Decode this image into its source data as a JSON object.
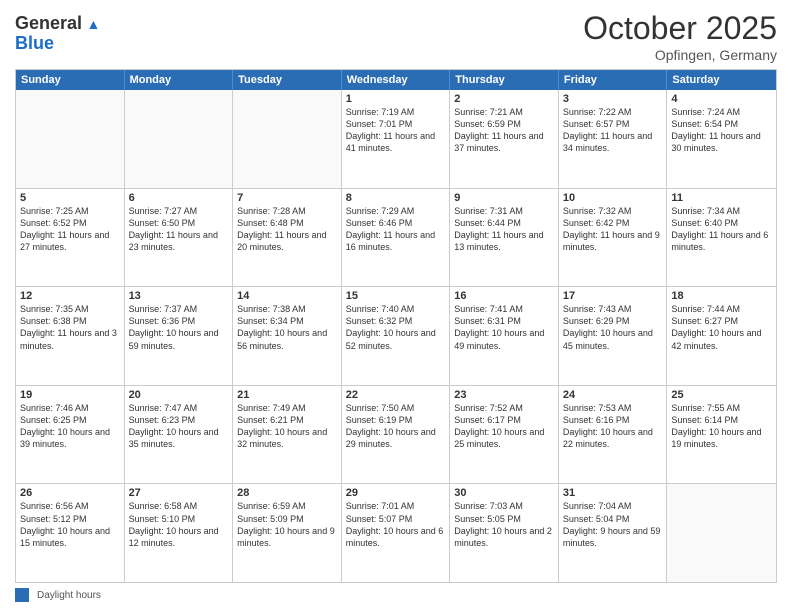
{
  "header": {
    "logo_general": "General",
    "logo_blue": "Blue",
    "title": "October 2025",
    "subtitle": "Opfingen, Germany"
  },
  "days_of_week": [
    "Sunday",
    "Monday",
    "Tuesday",
    "Wednesday",
    "Thursday",
    "Friday",
    "Saturday"
  ],
  "weeks": [
    [
      {
        "day": "",
        "sunrise": "",
        "sunset": "",
        "daylight": ""
      },
      {
        "day": "",
        "sunrise": "",
        "sunset": "",
        "daylight": ""
      },
      {
        "day": "",
        "sunrise": "",
        "sunset": "",
        "daylight": ""
      },
      {
        "day": "1",
        "sunrise": "Sunrise: 7:19 AM",
        "sunset": "Sunset: 7:01 PM",
        "daylight": "Daylight: 11 hours and 41 minutes."
      },
      {
        "day": "2",
        "sunrise": "Sunrise: 7:21 AM",
        "sunset": "Sunset: 6:59 PM",
        "daylight": "Daylight: 11 hours and 37 minutes."
      },
      {
        "day": "3",
        "sunrise": "Sunrise: 7:22 AM",
        "sunset": "Sunset: 6:57 PM",
        "daylight": "Daylight: 11 hours and 34 minutes."
      },
      {
        "day": "4",
        "sunrise": "Sunrise: 7:24 AM",
        "sunset": "Sunset: 6:54 PM",
        "daylight": "Daylight: 11 hours and 30 minutes."
      }
    ],
    [
      {
        "day": "5",
        "sunrise": "Sunrise: 7:25 AM",
        "sunset": "Sunset: 6:52 PM",
        "daylight": "Daylight: 11 hours and 27 minutes."
      },
      {
        "day": "6",
        "sunrise": "Sunrise: 7:27 AM",
        "sunset": "Sunset: 6:50 PM",
        "daylight": "Daylight: 11 hours and 23 minutes."
      },
      {
        "day": "7",
        "sunrise": "Sunrise: 7:28 AM",
        "sunset": "Sunset: 6:48 PM",
        "daylight": "Daylight: 11 hours and 20 minutes."
      },
      {
        "day": "8",
        "sunrise": "Sunrise: 7:29 AM",
        "sunset": "Sunset: 6:46 PM",
        "daylight": "Daylight: 11 hours and 16 minutes."
      },
      {
        "day": "9",
        "sunrise": "Sunrise: 7:31 AM",
        "sunset": "Sunset: 6:44 PM",
        "daylight": "Daylight: 11 hours and 13 minutes."
      },
      {
        "day": "10",
        "sunrise": "Sunrise: 7:32 AM",
        "sunset": "Sunset: 6:42 PM",
        "daylight": "Daylight: 11 hours and 9 minutes."
      },
      {
        "day": "11",
        "sunrise": "Sunrise: 7:34 AM",
        "sunset": "Sunset: 6:40 PM",
        "daylight": "Daylight: 11 hours and 6 minutes."
      }
    ],
    [
      {
        "day": "12",
        "sunrise": "Sunrise: 7:35 AM",
        "sunset": "Sunset: 6:38 PM",
        "daylight": "Daylight: 11 hours and 3 minutes."
      },
      {
        "day": "13",
        "sunrise": "Sunrise: 7:37 AM",
        "sunset": "Sunset: 6:36 PM",
        "daylight": "Daylight: 10 hours and 59 minutes."
      },
      {
        "day": "14",
        "sunrise": "Sunrise: 7:38 AM",
        "sunset": "Sunset: 6:34 PM",
        "daylight": "Daylight: 10 hours and 56 minutes."
      },
      {
        "day": "15",
        "sunrise": "Sunrise: 7:40 AM",
        "sunset": "Sunset: 6:32 PM",
        "daylight": "Daylight: 10 hours and 52 minutes."
      },
      {
        "day": "16",
        "sunrise": "Sunrise: 7:41 AM",
        "sunset": "Sunset: 6:31 PM",
        "daylight": "Daylight: 10 hours and 49 minutes."
      },
      {
        "day": "17",
        "sunrise": "Sunrise: 7:43 AM",
        "sunset": "Sunset: 6:29 PM",
        "daylight": "Daylight: 10 hours and 45 minutes."
      },
      {
        "day": "18",
        "sunrise": "Sunrise: 7:44 AM",
        "sunset": "Sunset: 6:27 PM",
        "daylight": "Daylight: 10 hours and 42 minutes."
      }
    ],
    [
      {
        "day": "19",
        "sunrise": "Sunrise: 7:46 AM",
        "sunset": "Sunset: 6:25 PM",
        "daylight": "Daylight: 10 hours and 39 minutes."
      },
      {
        "day": "20",
        "sunrise": "Sunrise: 7:47 AM",
        "sunset": "Sunset: 6:23 PM",
        "daylight": "Daylight: 10 hours and 35 minutes."
      },
      {
        "day": "21",
        "sunrise": "Sunrise: 7:49 AM",
        "sunset": "Sunset: 6:21 PM",
        "daylight": "Daylight: 10 hours and 32 minutes."
      },
      {
        "day": "22",
        "sunrise": "Sunrise: 7:50 AM",
        "sunset": "Sunset: 6:19 PM",
        "daylight": "Daylight: 10 hours and 29 minutes."
      },
      {
        "day": "23",
        "sunrise": "Sunrise: 7:52 AM",
        "sunset": "Sunset: 6:17 PM",
        "daylight": "Daylight: 10 hours and 25 minutes."
      },
      {
        "day": "24",
        "sunrise": "Sunrise: 7:53 AM",
        "sunset": "Sunset: 6:16 PM",
        "daylight": "Daylight: 10 hours and 22 minutes."
      },
      {
        "day": "25",
        "sunrise": "Sunrise: 7:55 AM",
        "sunset": "Sunset: 6:14 PM",
        "daylight": "Daylight: 10 hours and 19 minutes."
      }
    ],
    [
      {
        "day": "26",
        "sunrise": "Sunrise: 6:56 AM",
        "sunset": "Sunset: 5:12 PM",
        "daylight": "Daylight: 10 hours and 15 minutes."
      },
      {
        "day": "27",
        "sunrise": "Sunrise: 6:58 AM",
        "sunset": "Sunset: 5:10 PM",
        "daylight": "Daylight: 10 hours and 12 minutes."
      },
      {
        "day": "28",
        "sunrise": "Sunrise: 6:59 AM",
        "sunset": "Sunset: 5:09 PM",
        "daylight": "Daylight: 10 hours and 9 minutes."
      },
      {
        "day": "29",
        "sunrise": "Sunrise: 7:01 AM",
        "sunset": "Sunset: 5:07 PM",
        "daylight": "Daylight: 10 hours and 6 minutes."
      },
      {
        "day": "30",
        "sunrise": "Sunrise: 7:03 AM",
        "sunset": "Sunset: 5:05 PM",
        "daylight": "Daylight: 10 hours and 2 minutes."
      },
      {
        "day": "31",
        "sunrise": "Sunrise: 7:04 AM",
        "sunset": "Sunset: 5:04 PM",
        "daylight": "Daylight: 9 hours and 59 minutes."
      },
      {
        "day": "",
        "sunrise": "",
        "sunset": "",
        "daylight": ""
      }
    ]
  ],
  "footer": {
    "legend_label": "Daylight hours"
  }
}
